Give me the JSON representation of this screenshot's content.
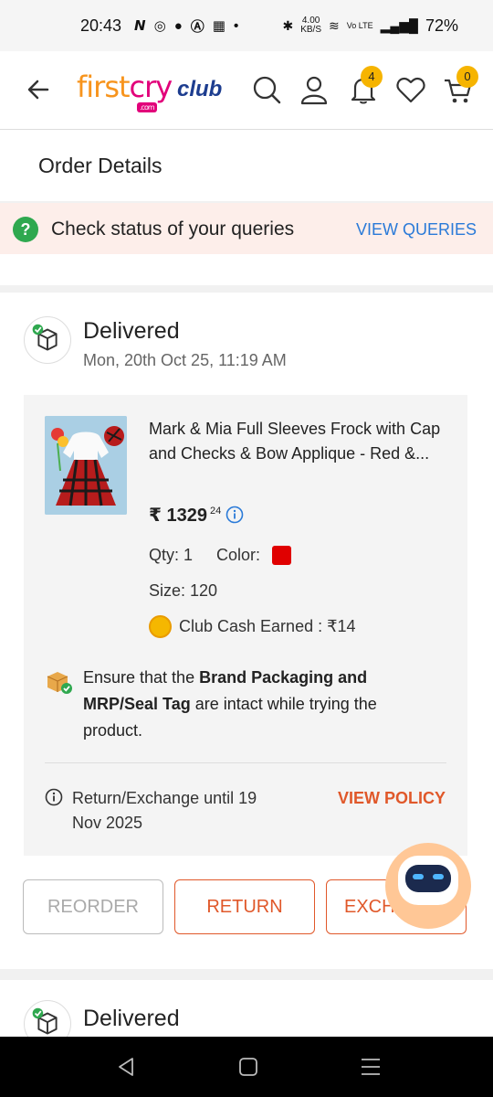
{
  "status_bar": {
    "time": "20:43",
    "network_speed": "4.00",
    "network_unit": "KB/S",
    "volte": "Vo LTE",
    "battery": "72%"
  },
  "header": {
    "logo_text_1": "first",
    "logo_text_2": "cry",
    "logo_com": ".com",
    "club_label": "club",
    "notification_count": "4",
    "cart_count": "0"
  },
  "page": {
    "title": "Order Details"
  },
  "queries": {
    "text": "Check status of your queries",
    "link": "VIEW QUERIES"
  },
  "order": {
    "status": "Delivered",
    "date": "Mon, 20th Oct 25, 11:19 AM",
    "product_name": "Mark & Mia Full Sleeves Frock with Cap and Checks & Bow Applique - Red &...",
    "price_currency": "₹",
    "price_main": "1329",
    "price_decimal": "24",
    "qty": "Qty: 1",
    "color_label": "Color:",
    "color_value": "#e00000",
    "size": "Size: 120",
    "club_cash": "Club Cash Earned : ₹14",
    "ensure_1": "Ensure that the ",
    "ensure_bold": "Brand Packaging and MRP/Seal Tag",
    "ensure_2": " are intact while trying the product.",
    "return_text": "Return/Exchange until 19 Nov 2025",
    "policy_link": "VIEW POLICY"
  },
  "buttons": {
    "reorder": "REORDER",
    "return": "RETURN",
    "exchange": "EXCHANGE"
  },
  "next_order": {
    "status": "Delivered"
  },
  "colors": {
    "accent": "#e0582a",
    "link": "#2a7ad8",
    "success": "#2fa84f"
  }
}
